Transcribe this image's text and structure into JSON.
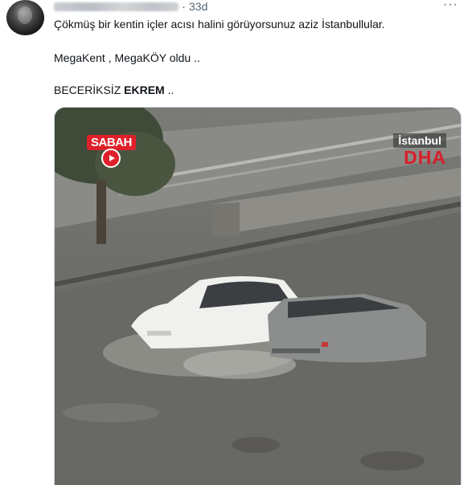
{
  "tweet": {
    "time": "33d",
    "separator": "·",
    "more": "···",
    "lines": [
      "Çökmüş bir kentin içler acısı halini görüyorsunuz aziz İstanbullular.",
      "MegaKent , MegaKÖY oldu ..",
      "BECERİKSİZ "
    ],
    "line3_bold": "EKREM",
    "line3_tail": " .."
  },
  "media": {
    "logo_left": "SABAH",
    "logo_right_city": "İstanbul",
    "logo_right_agency": "DHA",
    "colors": {
      "water": "#6e6e6b",
      "car_white": "#f2f2f2",
      "car_grey": "#8a8d8c",
      "logo_red": "#e0202a"
    }
  }
}
